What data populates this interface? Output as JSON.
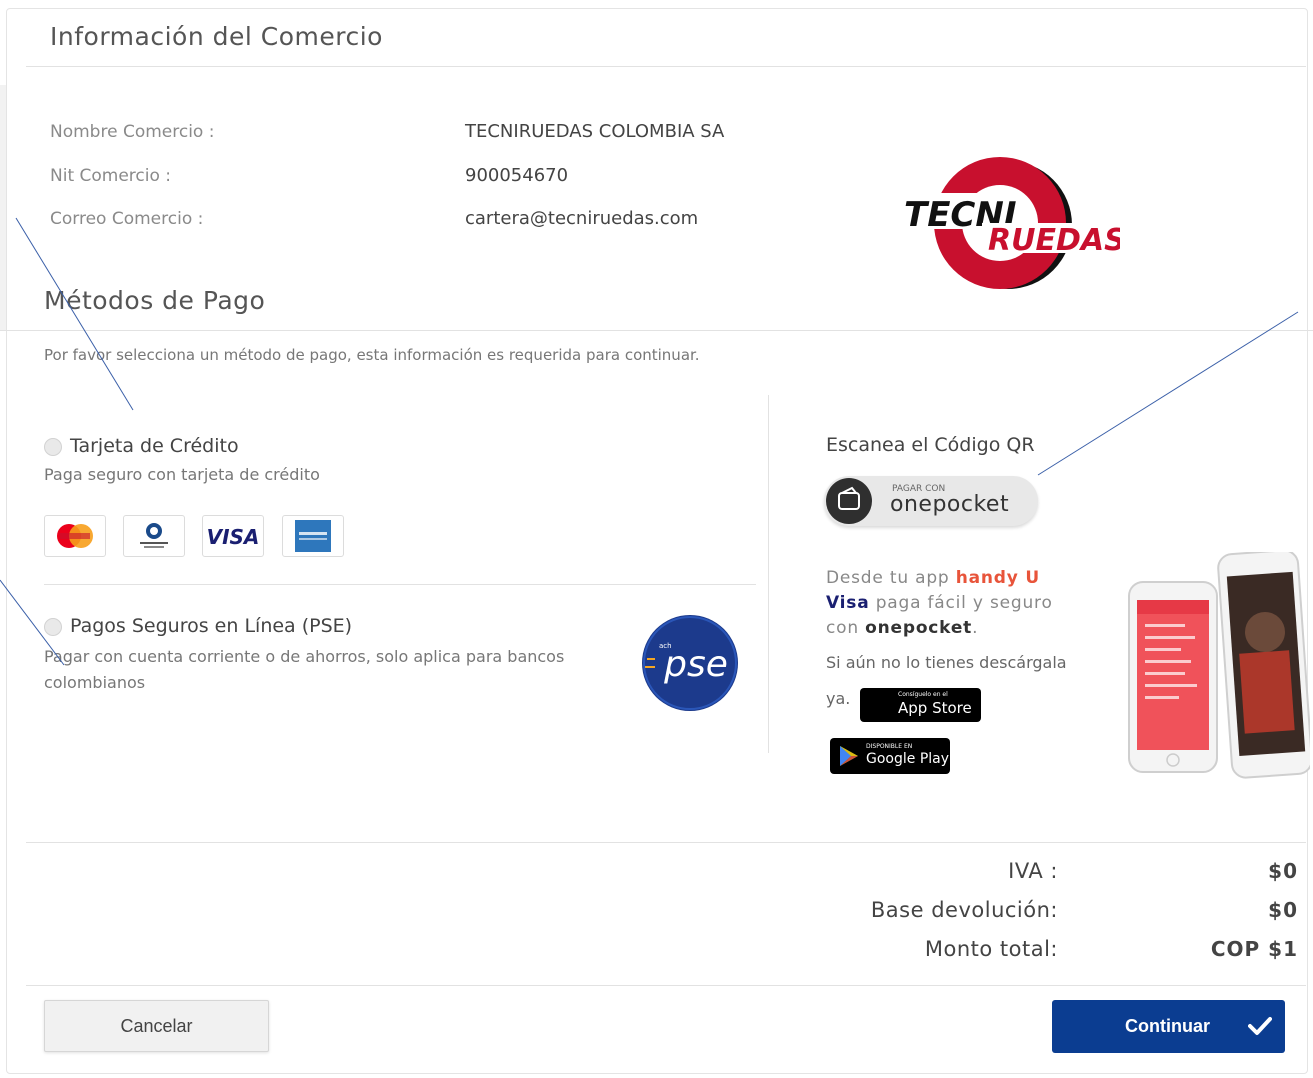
{
  "merchant": {
    "section_title": "Información del Comercio",
    "name_label": "Nombre Comercio :",
    "name_value": "TECNIRUEDAS COLOMBIA SA",
    "nit_label": "Nit Comercio :",
    "nit_value": "900054670",
    "email_label": "Correo Comercio :",
    "email_value": "cartera@tecniruedas.com",
    "logo_text_1": "TECNI",
    "logo_text_2": "RUEDAS",
    "logo_colors": {
      "red": "#c8102e",
      "black": "#111111"
    }
  },
  "payment": {
    "section_title": "Métodos de Pago",
    "instruction": "Por favor selecciona un método de pago, esta información es requerida para continuar.",
    "methods": [
      {
        "title": "Tarjeta de Crédito",
        "description": "Paga seguro con tarjeta de crédito",
        "selected": false
      },
      {
        "title": "Pagos Seguros en Línea (PSE)",
        "description": "Pagar con cuenta corriente o de ahorros, solo aplica para bancos colombianos",
        "selected": false
      }
    ],
    "cards": [
      {
        "icon": "mastercard-icon",
        "label": "MasterCard"
      },
      {
        "icon": "diners-club-icon",
        "label": "Diners Club International"
      },
      {
        "icon": "visa-icon",
        "label": "VISA"
      },
      {
        "icon": "american-express-icon",
        "label": "AMERICAN EXPRESS"
      }
    ],
    "pse_logo": "pse",
    "pse_logo_small": "ach"
  },
  "qr": {
    "title": "Escanea el Código QR",
    "button_small": "PAGAR CON",
    "button_big": "onepocket",
    "promo_1": "Desde tu app ",
    "promo_brand": "handy U",
    "promo_brand2": "Visa",
    "promo_2": " paga fácil y seguro con ",
    "promo_app": "onepocket",
    "promo_end": ".",
    "download_text": "Si aún no lo tienes descárgala",
    "download_ya": "ya.",
    "appstore_small": "Consíguelo en el",
    "appstore_big": "App Store",
    "googleplay_small": "DISPONIBLE EN",
    "googleplay_big": "Google Play",
    "colors": {
      "handy": "#e8543a",
      "visa": "#1a1f71",
      "button_bg": "#2f2f2f"
    }
  },
  "totals": {
    "iva_label": "IVA :",
    "iva_value": "$0",
    "base_label": "Base devolución:",
    "base_value": "$0",
    "total_label": "Monto total:",
    "total_value": "COP $1"
  },
  "actions": {
    "cancel_label": "Cancelar",
    "continue_label": "Continuar",
    "accent": "#0b3d91"
  }
}
